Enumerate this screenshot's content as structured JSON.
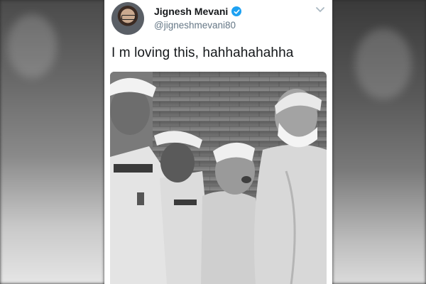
{
  "tweet": {
    "display_name": "Jignesh Mevani",
    "handle": "@jigneshmevani80",
    "text": "I m loving this, hahhahahahha",
    "verified": true
  },
  "icons": {
    "verified": "verified-badge-icon",
    "menu": "chevron-down-icon"
  },
  "colors": {
    "verified_blue": "#1da1f2",
    "handle_gray": "#657786",
    "text_black": "#14171a"
  }
}
